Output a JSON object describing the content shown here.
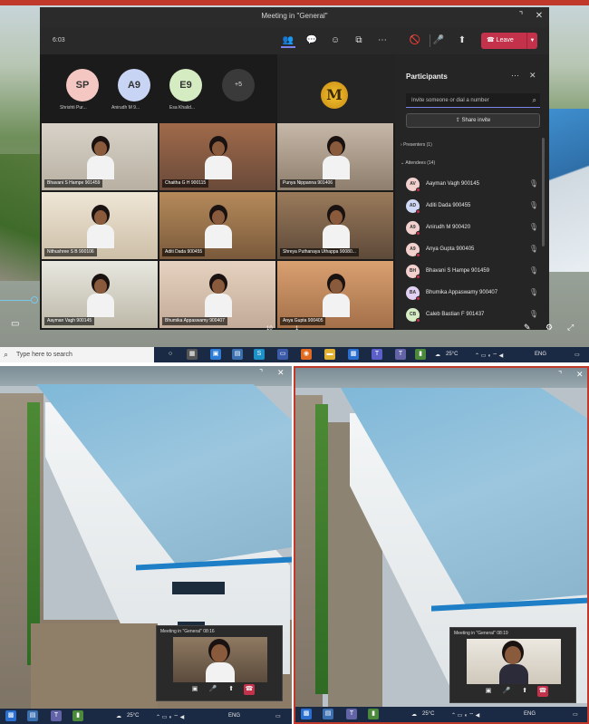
{
  "meeting": {
    "window_title": "Meeting in \"General\"",
    "timer": "6:03",
    "leave_label": "Leave",
    "toolbar_icons": [
      "people-icon",
      "chat-icon",
      "reactions-icon",
      "rooms-icon",
      "more-icon",
      "camera-off-icon",
      "mic-icon",
      "share-icon"
    ]
  },
  "top_avatars": [
    {
      "initials": "SP",
      "label": "Shrishti Pur...",
      "color": "#f4c7c3"
    },
    {
      "initials": "A9",
      "label": "Anirudh M 9...",
      "color": "#c7d4f4"
    },
    {
      "initials": "E9",
      "label": "Esa Khalid...",
      "color": "#d5ecc2"
    }
  ],
  "more_count": "+5",
  "logo_letter": "M",
  "video_tiles": [
    {
      "name": "Bhavani S Hampe 901459"
    },
    {
      "name": "Chaitha G H 900115"
    },
    {
      "name": "Punya Nippanna 901406"
    },
    {
      "name": "Nithushree S B 900106"
    },
    {
      "name": "Aditi Dada 900455"
    },
    {
      "name": "Shreya Puthanaya Uthappa 90080..."
    },
    {
      "name": "Aayman Vagh 900145"
    },
    {
      "name": "Bhumika Appaswamy 900407"
    },
    {
      "name": "Anya Gupta 900405"
    }
  ],
  "participants": {
    "title": "Participants",
    "invite_placeholder": "Invite someone or dial a number",
    "share_invite": "Share invite",
    "presenters_label": "Presenters (1)",
    "attendees_label": "Attendees (14)",
    "list": [
      {
        "initials": "AV",
        "name": "Aayman Vagh 900145",
        "color": "#f2d0cd"
      },
      {
        "initials": "AD",
        "name": "Aditi Dada 900455",
        "color": "#cfd8f4"
      },
      {
        "initials": "A9",
        "name": "Anirudh M 900420",
        "color": "#f2d0cd"
      },
      {
        "initials": "A9",
        "name": "Anya Gupta 900405",
        "color": "#f2d0cd"
      },
      {
        "initials": "BH",
        "name": "Bhavani S Hampe 901459",
        "color": "#f2d0cd"
      },
      {
        "initials": "BA",
        "name": "Bhumika Appaswamy 900407",
        "color": "#e2d0f2"
      },
      {
        "initials": "CB",
        "name": "Caleb Bastian F 901437",
        "color": "#d6ecc4"
      }
    ]
  },
  "taskbar_top": {
    "search_placeholder": "Type here to search",
    "temp": "25°C",
    "lang": "ENG"
  },
  "taskbar_bottom": {
    "temp": "25°C",
    "lang": "ENG"
  },
  "mini_windows": [
    {
      "title": "Meeting in \"General\"",
      "timer": "08:16"
    },
    {
      "title": "Meeting in \"General\"",
      "timer": "08:19"
    }
  ],
  "page_numbers": [
    "10",
    "1"
  ]
}
